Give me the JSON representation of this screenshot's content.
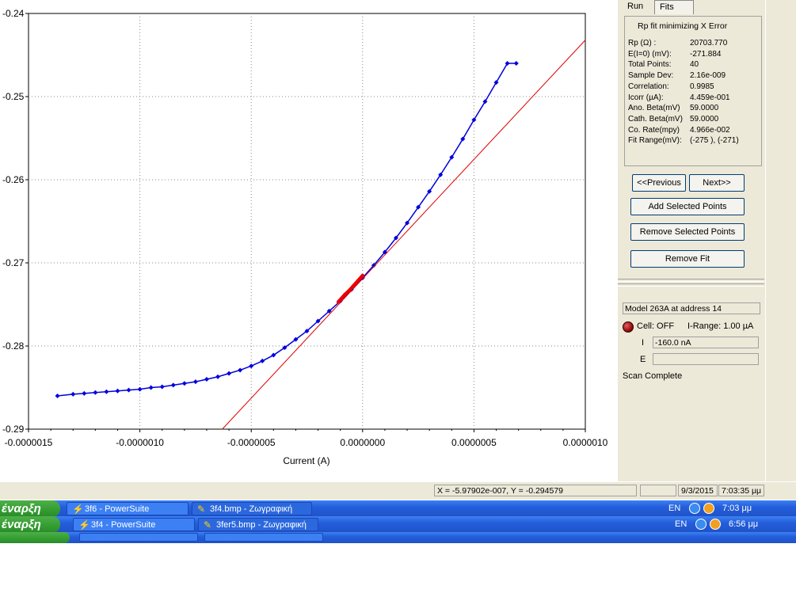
{
  "chart_data": {
    "type": "scatter",
    "xlabel": "Current (A)",
    "ylabel": "",
    "xlim": [
      -1.5e-06,
      1e-06
    ],
    "ylim": [
      -0.29,
      -0.24
    ],
    "x_ticks": [
      "-0.0000015",
      "-0.0000010",
      "-0.0000005",
      "0.0000000",
      "0.0000005",
      "0.0000010"
    ],
    "y_ticks": [
      "-0.24",
      "-0.25",
      "-0.26",
      "-0.27",
      "-0.28",
      "-0.29"
    ],
    "grid": true,
    "series": [
      {
        "color": "#0000dd",
        "x": [
          -1.37e-06,
          -1.3e-06,
          -1.25e-06,
          -1.2e-06,
          -1.15e-06,
          -1.1e-06,
          -1.05e-06,
          -1e-06,
          -9.5e-07,
          -9e-07,
          -8.5e-07,
          -8e-07,
          -7.5e-07,
          -7e-07,
          -6.5e-07,
          -6e-07,
          -5.5e-07,
          -5e-07,
          -4.5e-07,
          -4e-07,
          -3.5e-07,
          -3e-07,
          -2.5e-07,
          -2e-07,
          -1.5e-07,
          -1e-07,
          -5e-08,
          0.0,
          5e-08,
          1e-07,
          1.5e-07,
          2e-07,
          2.5e-07,
          3e-07,
          3.5e-07,
          4e-07,
          4.5e-07,
          5e-07,
          5.5e-07,
          6e-07,
          6.5e-07,
          6.9e-07
        ],
        "y": [
          -0.286,
          -0.2858,
          -0.2857,
          -0.2856,
          -0.2855,
          -0.2854,
          -0.2853,
          -0.2852,
          -0.285,
          -0.2849,
          -0.2847,
          -0.2845,
          -0.2843,
          -0.284,
          -0.2837,
          -0.2833,
          -0.2829,
          -0.2824,
          -0.2818,
          -0.2811,
          -0.2802,
          -0.2792,
          -0.2782,
          -0.277,
          -0.2758,
          -0.2746,
          -0.2732,
          -0.2718,
          -0.2703,
          -0.2687,
          -0.267,
          -0.2652,
          -0.2633,
          -0.2614,
          -0.2594,
          -0.2573,
          -0.2551,
          -0.2528,
          -0.2506,
          -0.2483,
          -0.246,
          -0.246
        ]
      },
      {
        "color": "#ee0000",
        "x": [
          -1.1e-07,
          -8e-08,
          -6e-08,
          -4e-08,
          -2e-08,
          0.0
        ],
        "y": [
          -0.2747,
          -0.2738,
          -0.2733,
          -0.2727,
          -0.2721,
          -0.2715
        ]
      },
      {
        "color": "#dd0000",
        "kind": "fit-line",
        "x": [
          -6.3e-07,
          1e-06
        ],
        "y": [
          -0.29,
          -0.2432
        ]
      }
    ]
  },
  "tabs": {
    "run": "Run",
    "fits": "Fits"
  },
  "fits": {
    "title": "Rp fit minimizing X Error",
    "rows": [
      {
        "label": "Rp (Ω) :",
        "value": "20703.770"
      },
      {
        "label": "E(I=0) (mV):",
        "value": "-271.884"
      },
      {
        "label": "Total Points:",
        "value": "40"
      },
      {
        "label": "Sample Dev:",
        "value": "2.16e-009"
      },
      {
        "label": "Correlation:",
        "value": "0.9985"
      },
      {
        "label": "Icorr (µA):",
        "value": "4.459e-001"
      },
      {
        "label": "Ano. Beta(mV)",
        "value": "59.0000"
      },
      {
        "label": "Cath. Beta(mV)",
        "value": "59.0000"
      },
      {
        "label": "Co. Rate(mpy)",
        "value": "4.966e-002"
      },
      {
        "label": "Fit Range(mV):",
        "value": "(-275 ), (-271)"
      }
    ],
    "buttons": {
      "previous": "<<Previous",
      "next": "Next>>",
      "add": "Add Selected Points",
      "remove_points": "Remove Selected Points",
      "remove_fit": "Remove Fit"
    }
  },
  "instrument": {
    "model": "Model 263A at address 14",
    "cell": "Cell: OFF",
    "irange": "I-Range: 1.00 µA",
    "i_label": "I",
    "i_value": "-160.0 nA",
    "e_label": "E",
    "e_value": "",
    "status": "Scan Complete"
  },
  "statusbar": {
    "coords": "X = -5.97902e-007, Y = -0.294579",
    "date": "9/3/2015",
    "time": "7:03:35 μμ"
  },
  "taskbar1": {
    "start": "έναρξη",
    "tasks": [
      "3f6 - PowerSuite",
      "3f4.bmp - Ζωγραφική"
    ],
    "lang": "EN",
    "clock": "7:03 μμ"
  },
  "taskbar2": {
    "start": "έναρξη",
    "tasks": [
      "3f4 - PowerSuite",
      "3fer5.bmp - Ζωγραφική"
    ],
    "lang": "EN",
    "clock": "6:56 μμ"
  }
}
